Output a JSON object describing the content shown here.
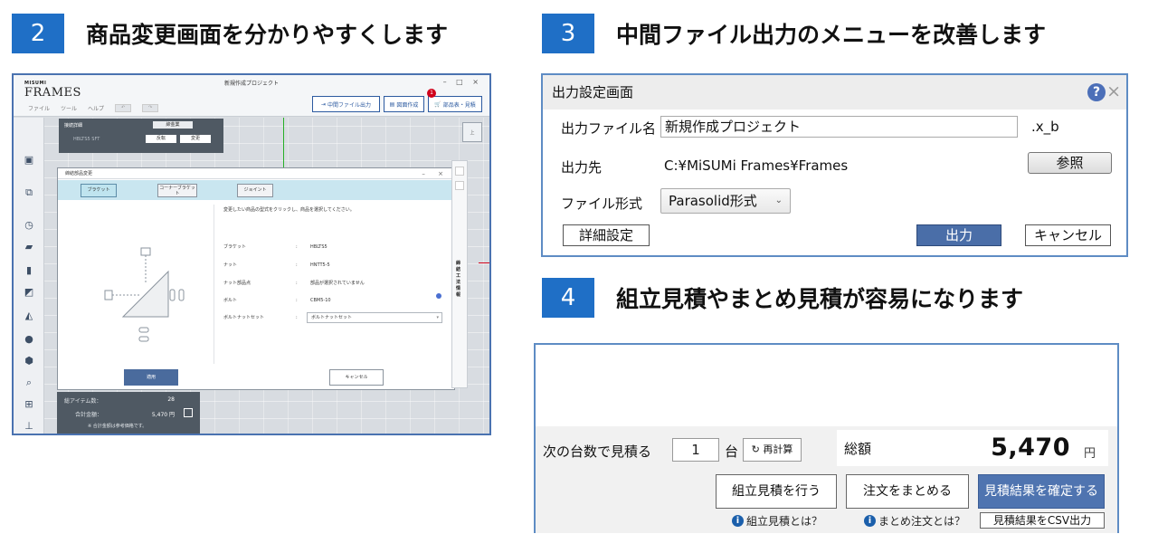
{
  "sections": [
    {
      "num": "2",
      "title": "商品変更画面を分かりやすくします"
    },
    {
      "num": "3",
      "title": "中間ファイル出力のメニューを改善します"
    },
    {
      "num": "4",
      "title": "組立見積やまとめ見積が容易になります"
    }
  ],
  "app": {
    "logo_small": "MISUMI",
    "logo_big": "FRAMES",
    "window_title": "新規作成プロジェクト",
    "window_controls": "– □ ×",
    "menu": [
      "ファイル",
      "ツール",
      "ヘルプ"
    ],
    "toolbar": {
      "export": "中間ファイル出力",
      "drawing": "図面作成",
      "estimate": "部品表・見積",
      "badge": "1"
    },
    "info_panel": {
      "label": "接続詳細",
      "value": "締金業",
      "item": "HBLTS5 SFT",
      "btn_flip": "反転",
      "btn_change": "変更"
    },
    "dialog": {
      "title": "締結部品変更",
      "controls": "– ×",
      "tabs": [
        "ブラケット",
        "コーナーブラケット",
        "ジョイント"
      ],
      "instruction": "変更したい商品の型式をクリックし、商品を選択してください。",
      "rows": [
        {
          "key": "ブラケット",
          "value": "HBLTS5"
        },
        {
          "key": "ナット",
          "value": "HNTT5-5"
        },
        {
          "key": "ナット部品点",
          "value": "部品が選択されていません"
        },
        {
          "key": "ボルト",
          "value": "CBM5-10"
        }
      ],
      "set_label": "ボルトナットセット",
      "set_value": "ボルトナットセット",
      "ok": "適用",
      "cancel": "キャンセル"
    },
    "right_rail_text": "締結工法情報",
    "cube_label": "上",
    "stats": {
      "items_label": "総アイテム数：",
      "items_value": "28",
      "total_label": "合計金額：",
      "total_value": "5,470 円",
      "note": "※ 合計金額は参考価格です。"
    }
  },
  "output_dialog": {
    "title": "出力設定画面",
    "help_icon": "?",
    "close_icon": "×",
    "file_name_label": "出力ファイル名",
    "file_name_value": "新規作成プロジェクト",
    "extension": ".x_b",
    "dest_label": "出力先",
    "dest_value": "C:¥MiSUMi Frames¥Frames",
    "browse": "参照",
    "format_label": "ファイル形式",
    "format_value": "Parasolid形式",
    "detail": "詳細設定",
    "output": "出力",
    "cancel": "キャンセル"
  },
  "estimate": {
    "qty_label": "次の台数で見積る",
    "qty_value": "1",
    "unit": "台",
    "recalc": "再計算",
    "total_label": "総額",
    "total_value": "5,470",
    "currency": "円",
    "btn_assembly": "組立見積を行う",
    "btn_combine": "注文をまとめる",
    "btn_confirm": "見積結果を確定する",
    "help_assembly": "組立見積とは？",
    "help_combine": "まとめ注文とは？",
    "btn_csv": "見積結果をCSV出力"
  },
  "colors": {
    "accent": "#1f6fc6",
    "frame_border": "#5e8cc4",
    "primary_button": "#4a6ea8"
  }
}
